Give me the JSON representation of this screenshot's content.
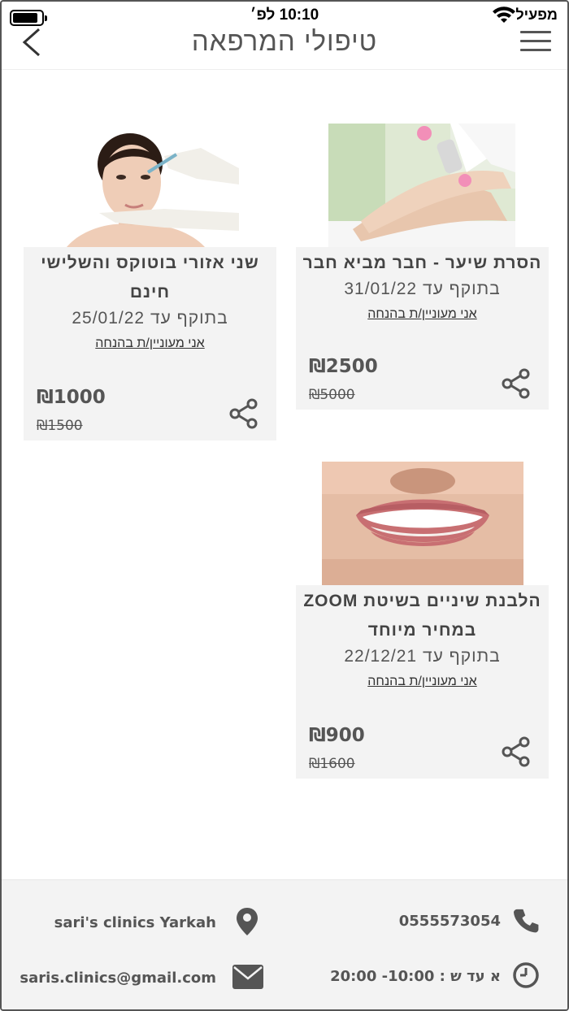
{
  "status_bar": {
    "carrier": "מפעיל",
    "time": "10:10 לפ׳"
  },
  "header": {
    "title": "טיפולי המרפאה"
  },
  "offers": [
    {
      "title": "הסרת שיער - חבר מביא חבר",
      "valid_until": "בתוקף עד 31/01/22",
      "interest_link": "אני מעוניין/ת בהנחה",
      "price": "₪2500",
      "old_price": "₪5000",
      "image": "laser-hair-removal-photo"
    },
    {
      "title": "שני אזורי בוטוקס והשלישי חינם",
      "valid_until": "בתוקף עד 25/01/22",
      "interest_link": "אני מעוניין/ת בהנחה",
      "price": "₪1000",
      "old_price": "₪1500",
      "image": "botox-injection-photo"
    },
    {
      "title": "הלבנת שיניים בשיטת ZOOM במחיר מיוחד",
      "valid_until": "בתוקף עד 22/12/21",
      "interest_link": "אני מעוניין/ת בהנחה",
      "price": "₪900",
      "old_price": "₪1600",
      "image": "teeth-whitening-photo"
    }
  ],
  "footer": {
    "phone": "0555573054",
    "address": "sari's clinics Yarkah",
    "hours": "א עד ש : 10:00- 20:00",
    "email": "saris.clinics@gmail.com"
  },
  "colors": {
    "card_bg": "#f3f3f3",
    "text": "#555555",
    "footer_bg": "#f3f3f3"
  }
}
